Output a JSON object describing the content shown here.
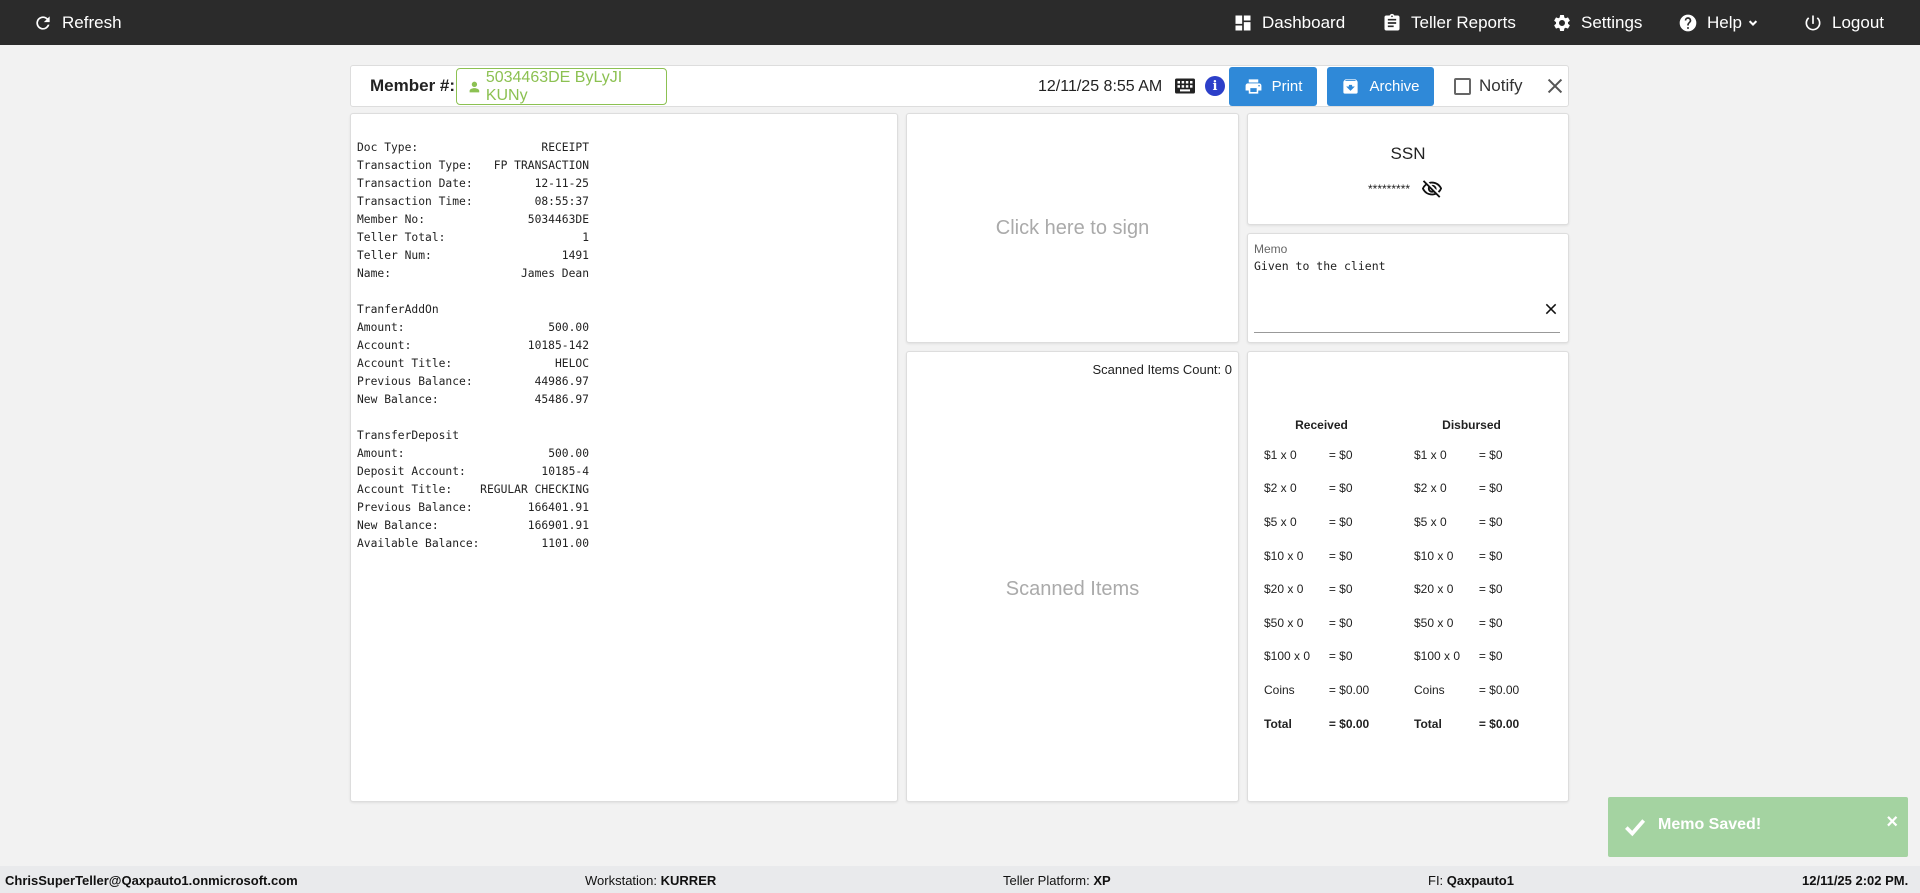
{
  "nav": {
    "refresh": "Refresh",
    "dashboard": "Dashboard",
    "teller_reports": "Teller Reports",
    "settings": "Settings",
    "help": "Help",
    "logout": "Logout"
  },
  "header": {
    "member_label": "Member #:",
    "member_value": "5034463DE ByLyJI KUNy",
    "datetime": "12/11/25 8:55 AM",
    "print_label": "Print",
    "archive_label": "Archive",
    "notify_label": "Notify"
  },
  "receipt": {
    "lines": [
      {
        "k": "Doc Type:",
        "v": "RECEIPT"
      },
      {
        "k": "Transaction Type:",
        "v": "FP TRANSACTION"
      },
      {
        "k": "Transaction Date:",
        "v": "12-11-25"
      },
      {
        "k": "Transaction Time:",
        "v": "08:55:37"
      },
      {
        "k": "Member No:",
        "v": "5034463DE"
      },
      {
        "k": "Teller Total:",
        "v": "1"
      },
      {
        "k": "Teller Num:",
        "v": "1491"
      },
      {
        "k": "Name:",
        "v": "James Dean"
      },
      {
        "k": "",
        "v": ""
      },
      {
        "k": "TranferAddOn",
        "v": ""
      },
      {
        "k": "Amount:",
        "v": "500.00"
      },
      {
        "k": "Account:",
        "v": "10185-142"
      },
      {
        "k": "Account Title:",
        "v": "HELOC"
      },
      {
        "k": "Previous Balance:",
        "v": "44986.97"
      },
      {
        "k": "New Balance:",
        "v": "45486.97"
      },
      {
        "k": "",
        "v": ""
      },
      {
        "k": "TransferDeposit",
        "v": ""
      },
      {
        "k": "Amount:",
        "v": "500.00"
      },
      {
        "k": "Deposit Account:",
        "v": "10185-4"
      },
      {
        "k": "Account Title:",
        "v": "REGULAR CHECKING"
      },
      {
        "k": "Previous Balance:",
        "v": "166401.91"
      },
      {
        "k": "New Balance:",
        "v": "166901.91"
      },
      {
        "k": "Available Balance:",
        "v": "1101.00"
      }
    ]
  },
  "sign": {
    "prompt": "Click here to sign"
  },
  "scanned": {
    "count_label": "Scanned Items Count: 0",
    "title": "Scanned Items"
  },
  "ssn": {
    "title": "SSN",
    "masked": "*********"
  },
  "memo": {
    "label": "Memo",
    "text": "Given to the client"
  },
  "cash": {
    "received_header": "Received",
    "disbursed_header": "Disbursed",
    "rows": [
      {
        "rc": "$1 x 0",
        "rv": "= $0",
        "dc": "$1 x 0",
        "dv": "= $0"
      },
      {
        "rc": "$2 x 0",
        "rv": "= $0",
        "dc": "$2 x 0",
        "dv": "= $0"
      },
      {
        "rc": "$5 x 0",
        "rv": "= $0",
        "dc": "$5 x 0",
        "dv": "= $0"
      },
      {
        "rc": "$10 x 0",
        "rv": "= $0",
        "dc": "$10 x 0",
        "dv": "= $0"
      },
      {
        "rc": "$20 x 0",
        "rv": "= $0",
        "dc": "$20 x 0",
        "dv": "= $0"
      },
      {
        "rc": "$50 x 0",
        "rv": "= $0",
        "dc": "$50 x 0",
        "dv": "= $0"
      },
      {
        "rc": "$100 x 0",
        "rv": "= $0",
        "dc": "$100 x 0",
        "dv": "= $0"
      },
      {
        "rc": "Coins",
        "rv": "= $0.00",
        "dc": "Coins",
        "dv": "= $0.00"
      }
    ],
    "total": {
      "rc": "Total",
      "rv": "= $0.00",
      "dc": "Total",
      "dv": "= $0.00"
    }
  },
  "toast": {
    "message": "Memo Saved!",
    "close": "×"
  },
  "footer": {
    "user": "ChrisSuperTeller@Qaxpauto1.onmicrosoft.com",
    "workstation_label": "Workstation:",
    "workstation_value": "KURRER",
    "platform_label": "Teller Platform:",
    "platform_value": "XP",
    "fi_label": "FI:",
    "fi_value": "Qaxpauto1",
    "datetime": "12/11/25 2:02 PM."
  },
  "colors": {
    "topbar": "#2b2b2b",
    "button_blue": "#2f89d8",
    "member_green": "#8cc152",
    "toast_green": "#a4d3a1"
  }
}
